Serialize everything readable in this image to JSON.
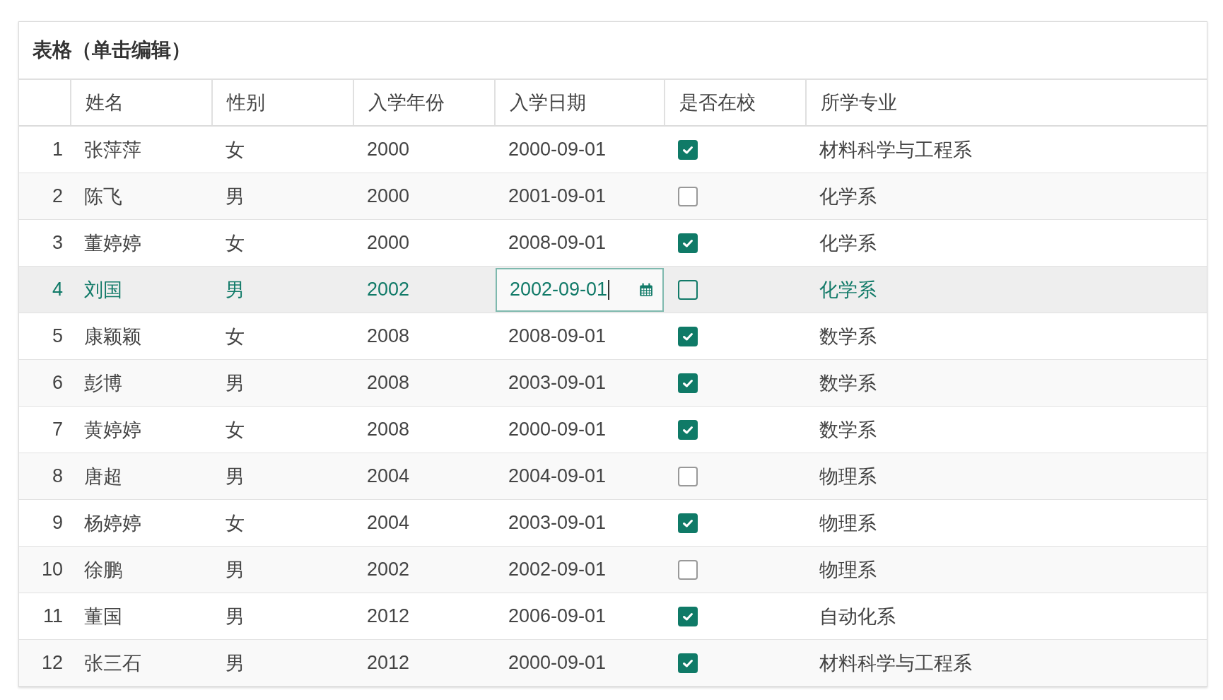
{
  "panel": {
    "title": "表格（单击编辑）"
  },
  "table": {
    "columns": [
      "姓名",
      "性别",
      "入学年份",
      "入学日期",
      "是否在校",
      "所学专业"
    ],
    "rows": [
      {
        "number": "1",
        "name": "张萍萍",
        "gender": "女",
        "year": "2000",
        "date": "2000-09-01",
        "in_school": true,
        "major": "材料科学与工程系",
        "selected": false,
        "editing": false
      },
      {
        "number": "2",
        "name": "陈飞",
        "gender": "男",
        "year": "2000",
        "date": "2001-09-01",
        "in_school": false,
        "major": "化学系",
        "selected": false,
        "editing": false
      },
      {
        "number": "3",
        "name": "董婷婷",
        "gender": "女",
        "year": "2000",
        "date": "2008-09-01",
        "in_school": true,
        "major": "化学系",
        "selected": false,
        "editing": false
      },
      {
        "number": "4",
        "name": "刘国",
        "gender": "男",
        "year": "2002",
        "date": "2002-09-01",
        "in_school": false,
        "major": "化学系",
        "selected": true,
        "editing": true
      },
      {
        "number": "5",
        "name": "康颖颖",
        "gender": "女",
        "year": "2008",
        "date": "2008-09-01",
        "in_school": true,
        "major": "数学系",
        "selected": false,
        "editing": false
      },
      {
        "number": "6",
        "name": "彭博",
        "gender": "男",
        "year": "2008",
        "date": "2003-09-01",
        "in_school": true,
        "major": "数学系",
        "selected": false,
        "editing": false
      },
      {
        "number": "7",
        "name": "黄婷婷",
        "gender": "女",
        "year": "2008",
        "date": "2000-09-01",
        "in_school": true,
        "major": "数学系",
        "selected": false,
        "editing": false
      },
      {
        "number": "8",
        "name": "唐超",
        "gender": "男",
        "year": "2004",
        "date": "2004-09-01",
        "in_school": false,
        "major": "物理系",
        "selected": false,
        "editing": false
      },
      {
        "number": "9",
        "name": "杨婷婷",
        "gender": "女",
        "year": "2004",
        "date": "2003-09-01",
        "in_school": true,
        "major": "物理系",
        "selected": false,
        "editing": false
      },
      {
        "number": "10",
        "name": "徐鹏",
        "gender": "男",
        "year": "2002",
        "date": "2002-09-01",
        "in_school": false,
        "major": "物理系",
        "selected": false,
        "editing": false
      },
      {
        "number": "11",
        "name": "董国",
        "gender": "男",
        "year": "2012",
        "date": "2006-09-01",
        "in_school": true,
        "major": "自动化系",
        "selected": false,
        "editing": false
      },
      {
        "number": "12",
        "name": "张三石",
        "gender": "男",
        "year": "2012",
        "date": "2000-09-01",
        "in_school": true,
        "major": "材料科学与工程系",
        "selected": false,
        "editing": false
      }
    ]
  }
}
